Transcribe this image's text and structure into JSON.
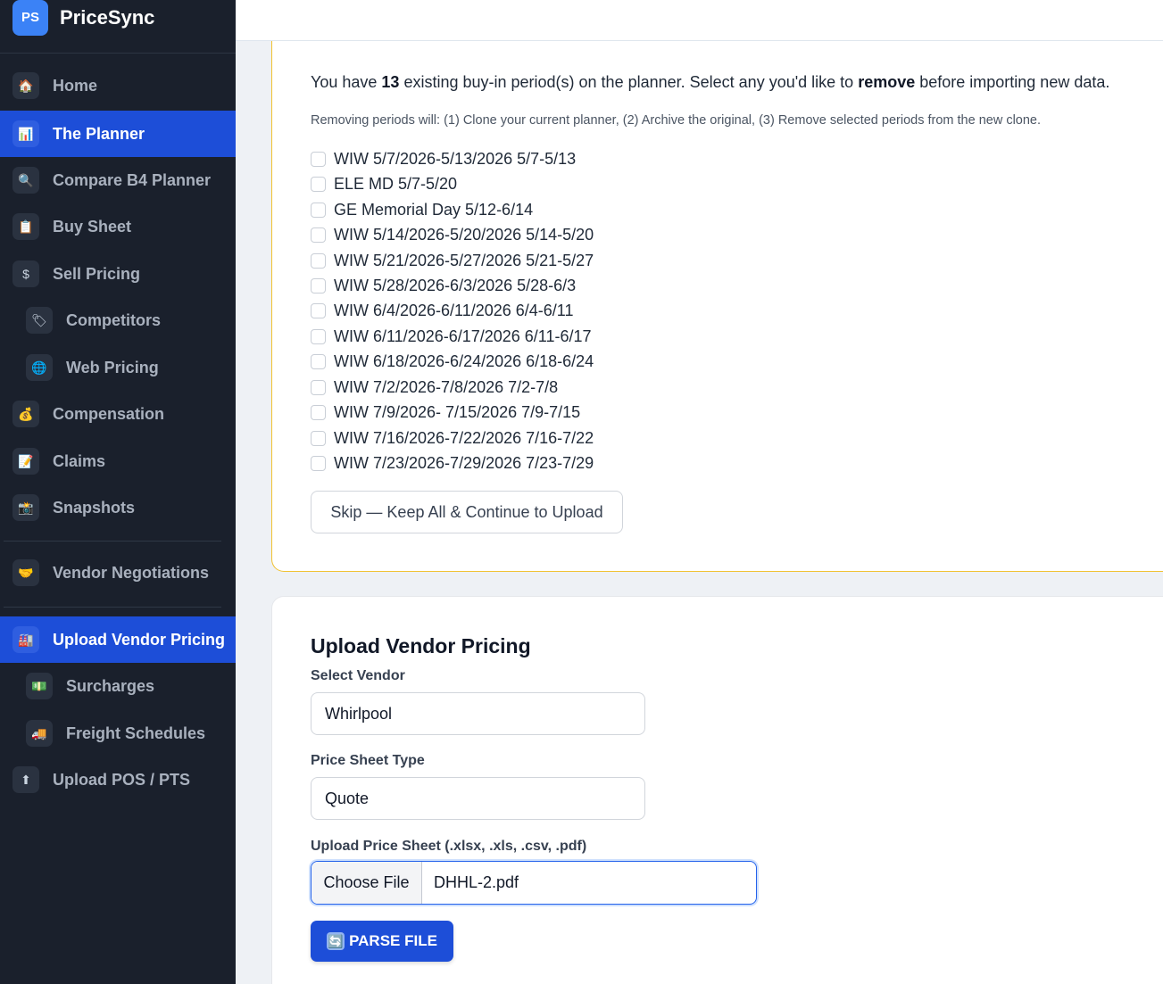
{
  "brand": {
    "logo": "PS",
    "name": "PriceSync"
  },
  "nav": [
    {
      "label": "Home",
      "icon": "🏠"
    },
    {
      "label": "The Planner",
      "icon": "📊"
    },
    {
      "label": "Compare B4 Planner",
      "icon": "🔍"
    },
    {
      "label": "Buy Sheet",
      "icon": "📋"
    },
    {
      "label": "Sell Pricing",
      "icon": "$"
    },
    {
      "label": "Competitors",
      "icon": "🏷"
    },
    {
      "label": "Web Pricing",
      "icon": "🌐"
    },
    {
      "label": "Compensation",
      "icon": "💰"
    },
    {
      "label": "Claims",
      "icon": "📝"
    },
    {
      "label": "Snapshots",
      "icon": "📸"
    },
    {
      "label": "Vendor Negotiations",
      "icon": "🤝"
    },
    {
      "label": "Upload Vendor Pricing",
      "icon": "🏭"
    },
    {
      "label": "Surcharges",
      "icon": "💵"
    },
    {
      "label": "Freight Schedules",
      "icon": "🚚"
    },
    {
      "label": "Upload POS / PTS",
      "icon": "⬆"
    }
  ],
  "remove_periods": {
    "intro_prefix": "You have ",
    "count": "13",
    "intro_middle": " existing buy-in period(s) on the planner. Select any you'd like to ",
    "intro_bold": "remove",
    "intro_suffix": " before importing new data.",
    "note": "Removing periods will: (1) Clone your current planner, (2) Archive the original, (3) Remove selected periods from the new clone.",
    "periods": [
      "WIW 5/7/2026-5/13/2026 5/7-5/13",
      "ELE MD 5/7-5/20",
      "GE Memorial Day 5/12-6/14",
      "WIW 5/14/2026-5/20/2026 5/14-5/20",
      "WIW 5/21/2026-5/27/2026 5/21-5/27",
      "WIW 5/28/2026-6/3/2026 5/28-6/3",
      "WIW 6/4/2026-6/11/2026 6/4-6/11",
      "WIW 6/11/2026-6/17/2026 6/11-6/17",
      "WIW 6/18/2026-6/24/2026 6/18-6/24",
      "WIW 7/2/2026-7/8/2026 7/2-7/8",
      "WIW 7/9/2026- 7/15/2026 7/9-7/15",
      "WIW 7/16/2026-7/22/2026 7/16-7/22",
      "WIW 7/23/2026-7/29/2026 7/23-7/29"
    ],
    "skip_button": "Skip — Keep All & Continue to Upload"
  },
  "upload": {
    "title": "Upload Vendor Pricing",
    "vendor_label": "Select Vendor",
    "vendor_value": "Whirlpool",
    "type_label": "Price Sheet Type",
    "type_value": "Quote",
    "file_label": "Upload Price Sheet (.xlsx, .xls, .csv, .pdf)",
    "choose_file": "Choose File",
    "file_name": "DHHL-2.pdf",
    "parse_icon": "🔄",
    "parse_button": "PARSE FILE"
  },
  "colors": {
    "accent": "#1d4ed8",
    "sidebar": "#1a202c",
    "warning_border": "#f1c232"
  }
}
